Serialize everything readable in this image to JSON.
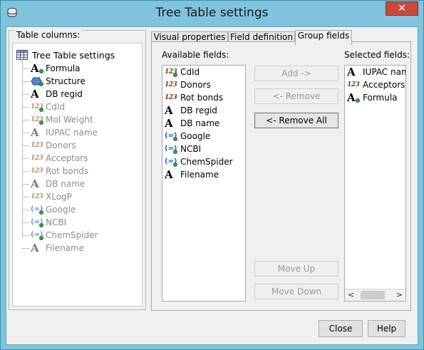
{
  "window": {
    "title": "Tree Table settings",
    "close_glyph": "✕"
  },
  "left": {
    "legend": "Table columns:",
    "root": "Tree Table settings",
    "items": [
      {
        "label": "Formula",
        "icon": "A",
        "enabled": true,
        "dot": true
      },
      {
        "label": "Structure",
        "icon": "structure",
        "enabled": true,
        "dot": true
      },
      {
        "label": "DB regid",
        "icon": "A",
        "enabled": true,
        "dot": false
      },
      {
        "label": "CdId",
        "icon": "123",
        "enabled": false,
        "dot": true
      },
      {
        "label": "Mol Weight",
        "icon": "123",
        "enabled": false,
        "dot": true
      },
      {
        "label": "IUPAC name",
        "icon": "A",
        "enabled": false,
        "dot": false
      },
      {
        "label": "Donors",
        "icon": "123",
        "enabled": false,
        "dot": false
      },
      {
        "label": "Acceptors",
        "icon": "123",
        "enabled": false,
        "dot": false
      },
      {
        "label": "Rot bonds",
        "icon": "123",
        "enabled": false,
        "dot": false
      },
      {
        "label": "DB name",
        "icon": "A",
        "enabled": false,
        "dot": false
      },
      {
        "label": "XLogP",
        "icon": "123",
        "enabled": false,
        "dot": false
      },
      {
        "label": "Google",
        "icon": "link",
        "enabled": false,
        "dot": true
      },
      {
        "label": "NCBI",
        "icon": "link",
        "enabled": false,
        "dot": true
      },
      {
        "label": "ChemSpider",
        "icon": "link",
        "enabled": false,
        "dot": true
      },
      {
        "label": "Filename",
        "icon": "A",
        "enabled": false,
        "dot": false
      }
    ]
  },
  "tabs": [
    {
      "label": "Visual properties"
    },
    {
      "label": "Field definition"
    },
    {
      "label": "Group fields"
    }
  ],
  "group": {
    "available_label": "Available fields:",
    "selected_label": "Selected fields:",
    "available": [
      {
        "label": "CdId",
        "icon": "123",
        "dot": true
      },
      {
        "label": "Donors",
        "icon": "123",
        "dot": false
      },
      {
        "label": "Rot bonds",
        "icon": "123",
        "dot": false
      },
      {
        "label": "DB regid",
        "icon": "A",
        "dot": false
      },
      {
        "label": "DB name",
        "icon": "A",
        "dot": false
      },
      {
        "label": "Google",
        "icon": "link",
        "dot": true
      },
      {
        "label": "NCBI",
        "icon": "link",
        "dot": true
      },
      {
        "label": "ChemSpider",
        "icon": "link",
        "dot": true
      },
      {
        "label": "Filename",
        "icon": "A",
        "dot": false
      }
    ],
    "selected": [
      {
        "label": "IUPAC nam",
        "icon": "A",
        "dot": false
      },
      {
        "label": "Acceptors",
        "icon": "123",
        "dot": false
      },
      {
        "label": "Formula",
        "icon": "A",
        "dot": true
      }
    ],
    "buttons": {
      "add": "Add ->",
      "remove": "<- Remove",
      "remove_all": "<- Remove All",
      "move_up": "Move Up",
      "move_down": "Move Down"
    }
  },
  "footer": {
    "close": "Close",
    "help": "Help"
  }
}
